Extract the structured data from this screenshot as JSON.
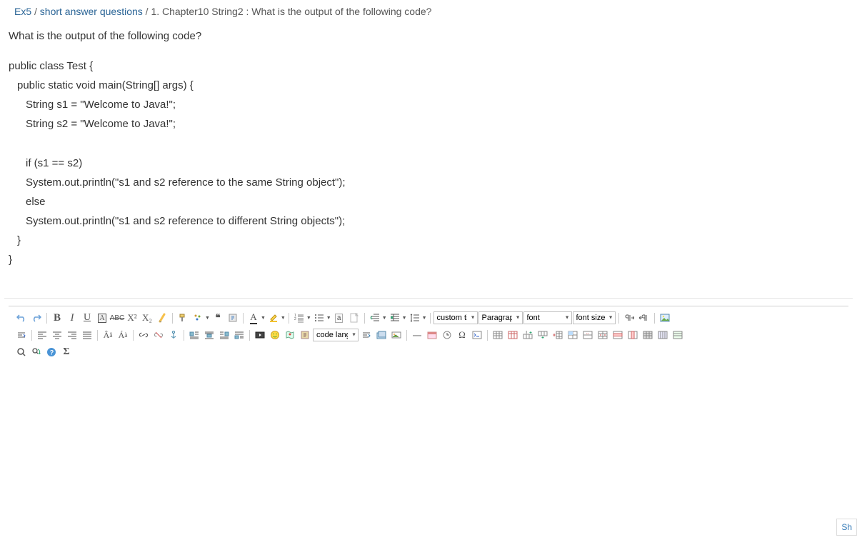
{
  "breadcrumb": {
    "root": "Ex5",
    "mid": "short answer questions",
    "current": "1. Chapter10 String2 : What is the output of the following code?"
  },
  "question": "What is the output of the following code?",
  "code": {
    "l1": "public class Test {",
    "l2": "public static void main(String[] args) {",
    "l3": "String s1 = \"Welcome to Java!\";",
    "l4": "String s2 = \"Welcome to Java!\";",
    "l5": "if (s1 == s2)",
    "l6": "System.out.println(\"s1 and s2 reference to the same String object\");",
    "l7": "else",
    "l8": "System.out.println(\"s1 and s2 reference to different String objects\");",
    "l9": "}",
    "l10": "}"
  },
  "toolbar": {
    "bold": "B",
    "italic": "I",
    "underline": "U",
    "boxA": "A",
    "strike": "ABC",
    "supx": "X²",
    "subx": "X₂",
    "quote": "❝",
    "fcolor": "A",
    "custom_title": "custom titl",
    "paragraph": "Paragraph",
    "font": "font",
    "font_size": "font size",
    "code_lang": "code langu",
    "sigma": "Σ",
    "omega": "Ω",
    "dash": "—"
  },
  "side": "Sh"
}
